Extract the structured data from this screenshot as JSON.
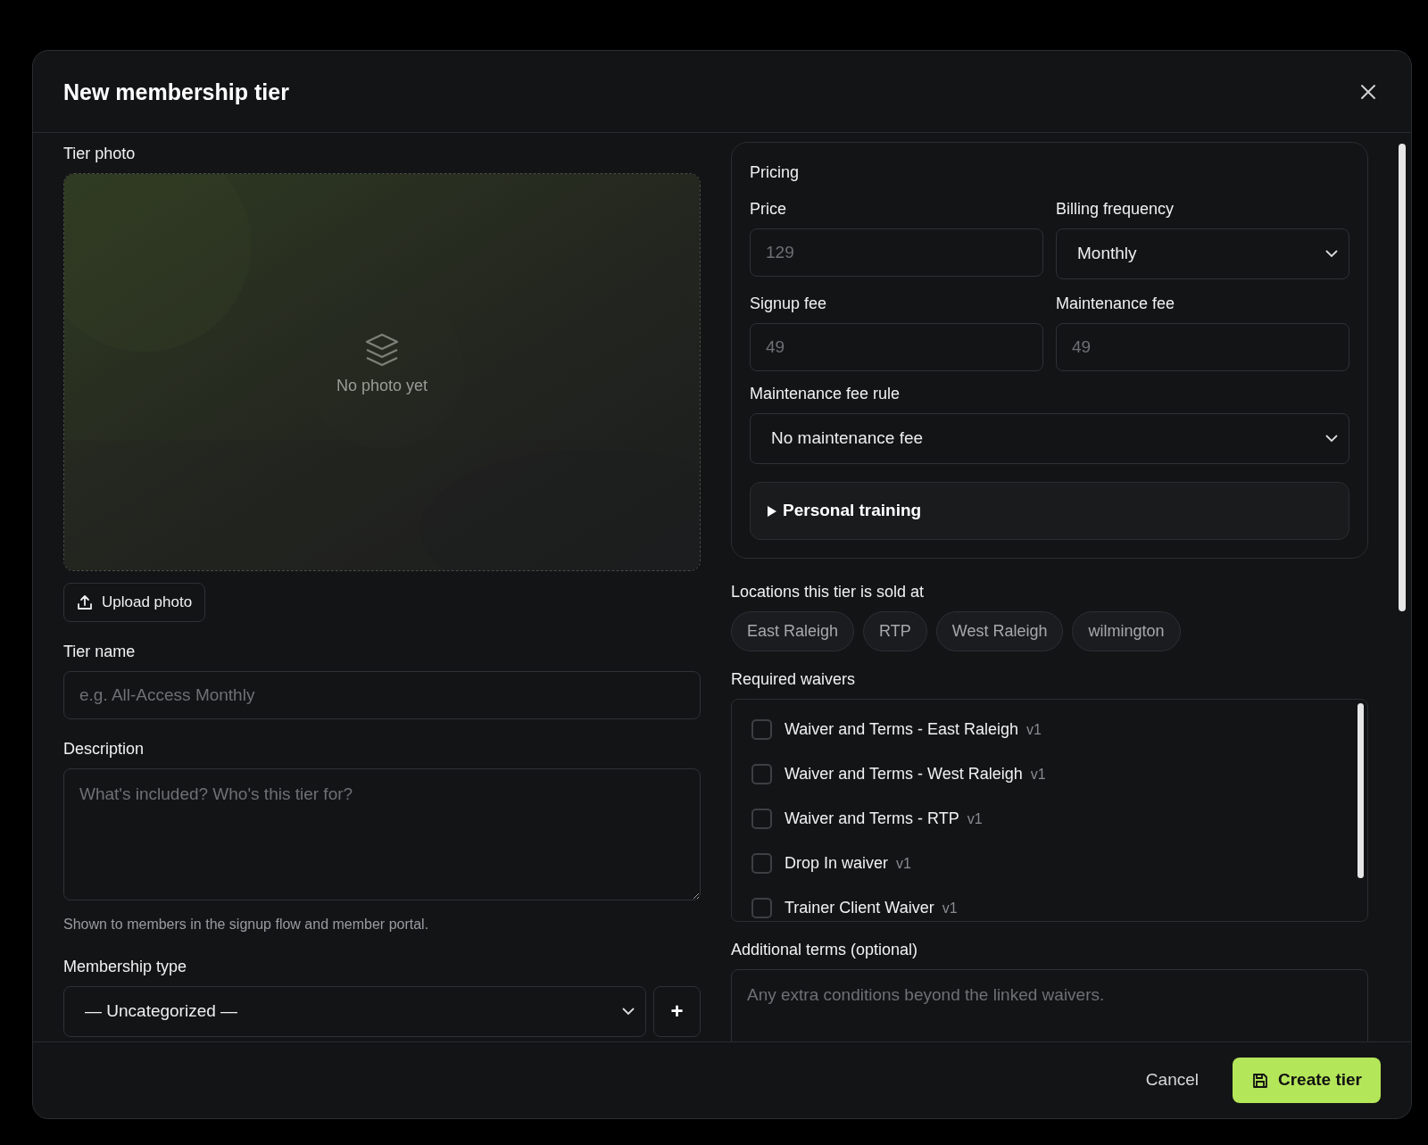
{
  "dialog": {
    "title": "New membership tier"
  },
  "photo": {
    "label": "Tier photo",
    "empty_text": "No photo yet",
    "upload_button": "Upload photo"
  },
  "tier_name": {
    "label": "Tier name",
    "placeholder": "e.g. All-Access Monthly"
  },
  "description": {
    "label": "Description",
    "placeholder": "What's included? Who's this tier for?",
    "help": "Shown to members in the signup flow and member portal."
  },
  "membership_type": {
    "label": "Membership type",
    "value": "— Uncategorized —",
    "add_button": "+"
  },
  "pricing": {
    "title": "Pricing",
    "price": {
      "label": "Price",
      "placeholder": "129"
    },
    "billing_frequency": {
      "label": "Billing frequency",
      "value": "Monthly"
    },
    "signup_fee": {
      "label": "Signup fee",
      "placeholder": "49"
    },
    "maintenance_fee": {
      "label": "Maintenance fee",
      "placeholder": "49"
    },
    "maintenance_fee_rule": {
      "label": "Maintenance fee rule",
      "value": "No maintenance fee"
    },
    "personal_training": {
      "label": "Personal training",
      "expanded": false
    }
  },
  "locations": {
    "label": "Locations this tier is sold at",
    "items": [
      {
        "label": "East Raleigh",
        "selected": false
      },
      {
        "label": "RTP",
        "selected": false
      },
      {
        "label": "West Raleigh",
        "selected": false
      },
      {
        "label": "wilmington",
        "selected": false
      }
    ]
  },
  "waivers": {
    "label": "Required waivers",
    "items": [
      {
        "name": "Waiver and Terms - East Raleigh",
        "version": "v1",
        "checked": false
      },
      {
        "name": "Waiver and Terms - West Raleigh",
        "version": "v1",
        "checked": false
      },
      {
        "name": "Waiver and Terms - RTP",
        "version": "v1",
        "checked": false
      },
      {
        "name": "Drop In waiver",
        "version": "v1",
        "checked": false
      },
      {
        "name": "Trainer Client Waiver",
        "version": "v1",
        "checked": false
      }
    ]
  },
  "additional_terms": {
    "label": "Additional terms (optional)",
    "placeholder": "Any extra conditions beyond the linked waivers."
  },
  "footer": {
    "cancel": "Cancel",
    "create": "Create tier"
  }
}
